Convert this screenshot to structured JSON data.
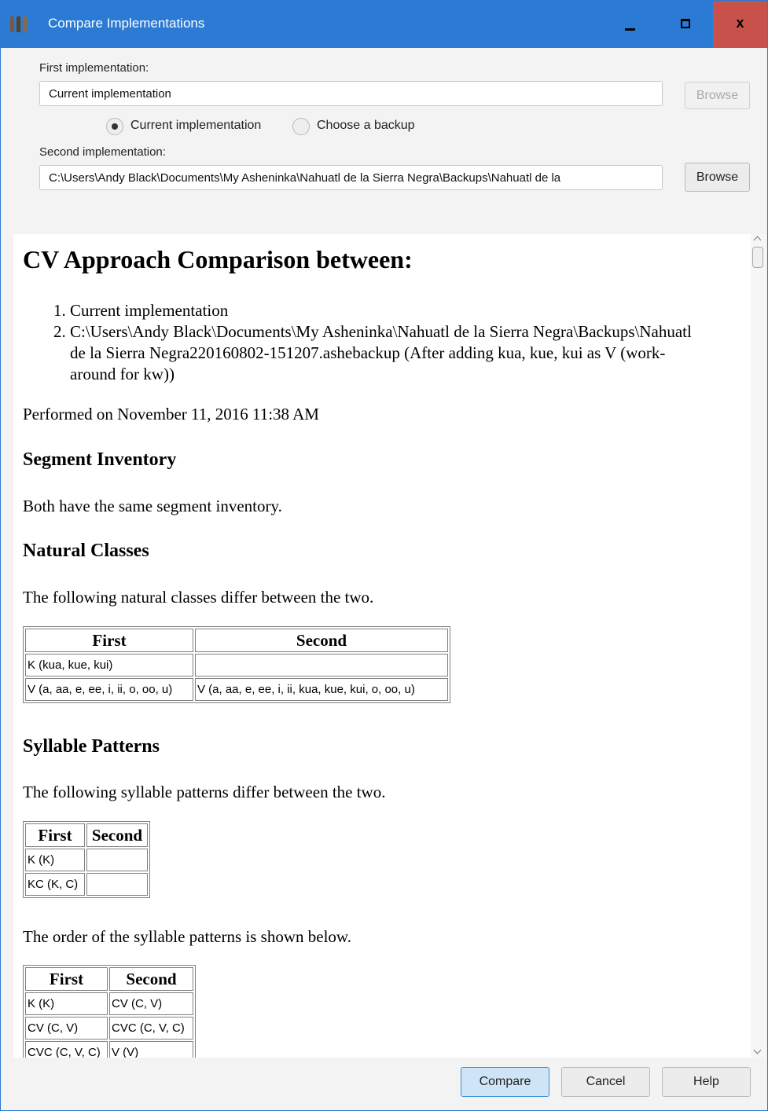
{
  "window": {
    "title": "Compare Implementations",
    "close_glyph": "x"
  },
  "form": {
    "first_label": "First implementation:",
    "first_value": "Current implementation",
    "browse_label": "Browse",
    "radio_current": "Current implementation",
    "radio_backup": "Choose a backup",
    "second_label": "Second implementation:",
    "second_value": "C:\\Users\\Andy Black\\Documents\\My Asheninka\\Nahuatl de la Sierra Negra\\Backups\\Nahuatl de la"
  },
  "report": {
    "heading": "CV Approach Comparison between:",
    "items": [
      "Current implementation",
      "C:\\Users\\Andy Black\\Documents\\My Asheninka\\Nahuatl de la Sierra Negra\\Backups\\Nahuatl de la Sierra Negra220160802-151207.ashebackup (After adding kua, kue, kui as V (work-around for kw))"
    ],
    "performed": "Performed on November 11, 2016 11:38 AM",
    "segment_heading": "Segment Inventory",
    "segment_text": "Both have the same segment inventory.",
    "classes_heading": "Natural Classes",
    "classes_text": "The following natural classes differ between the two.",
    "classes_table": {
      "headers": [
        "First",
        "Second"
      ],
      "rows": [
        [
          "K (kua, kue, kui)",
          ""
        ],
        [
          "V (a, aa, e, ee, i, ii, o, oo, u)",
          "V (a, aa, e, ee, i, ii, kua, kue, kui, o, oo, u)"
        ]
      ]
    },
    "patterns_heading": "Syllable Patterns",
    "patterns_text": "The following syllable patterns differ between the two.",
    "patterns_table": {
      "headers": [
        "First",
        "Second"
      ],
      "rows": [
        [
          "K (K)",
          ""
        ],
        [
          "KC (K, C)",
          ""
        ]
      ]
    },
    "order_text": "The order of the syllable patterns is shown below.",
    "order_table": {
      "headers": [
        "First",
        "Second"
      ],
      "rows": [
        [
          "K (K)",
          "CV (C, V)"
        ],
        [
          "CV (C, V)",
          "CVC (C, V, C)"
        ],
        [
          "CVC (C, V, C)",
          "V (V)"
        ]
      ]
    }
  },
  "footer": {
    "compare": "Compare",
    "cancel": "Cancel",
    "help": "Help"
  }
}
